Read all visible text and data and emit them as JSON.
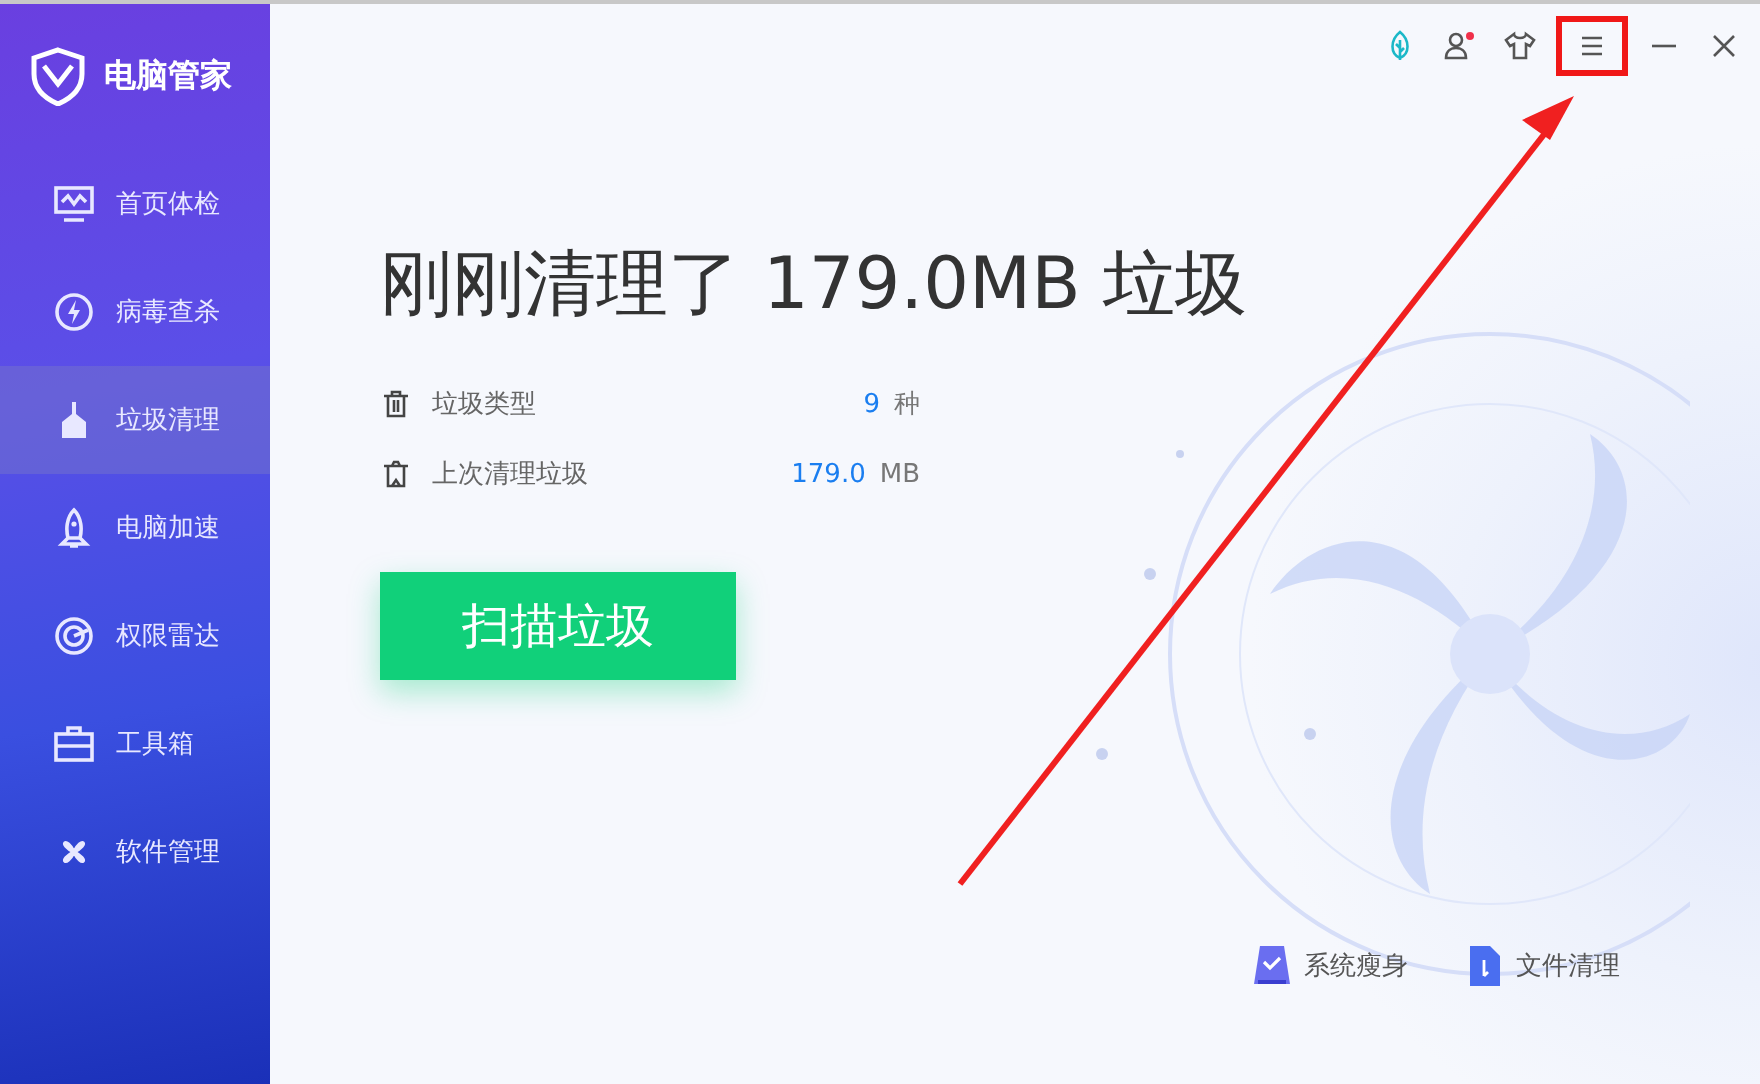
{
  "app": {
    "name": "电脑管家"
  },
  "sidebar": {
    "items": [
      {
        "label": "首页体检",
        "selected": false
      },
      {
        "label": "病毒查杀",
        "selected": false
      },
      {
        "label": "垃圾清理",
        "selected": true
      },
      {
        "label": "电脑加速",
        "selected": false
      },
      {
        "label": "权限雷达",
        "selected": false
      },
      {
        "label": "工具箱",
        "selected": false
      },
      {
        "label": "软件管理",
        "selected": false
      }
    ]
  },
  "titlebar": {
    "buttons": [
      {
        "highlighted": false
      },
      {
        "highlighted": false
      },
      {
        "highlighted": false
      },
      {
        "highlighted": true
      },
      {
        "highlighted": false
      },
      {
        "highlighted": false
      }
    ]
  },
  "headline": "刚刚清理了 179.0MB 垃圾",
  "stats": [
    {
      "label": "垃圾类型",
      "value": "9",
      "unit": "种"
    },
    {
      "label": "上次清理垃圾",
      "value": "179.0",
      "unit": "MB"
    }
  ],
  "scan_button": "扫描垃圾",
  "tools": [
    {
      "label": "系统瘦身"
    },
    {
      "label": "文件清理"
    }
  ]
}
